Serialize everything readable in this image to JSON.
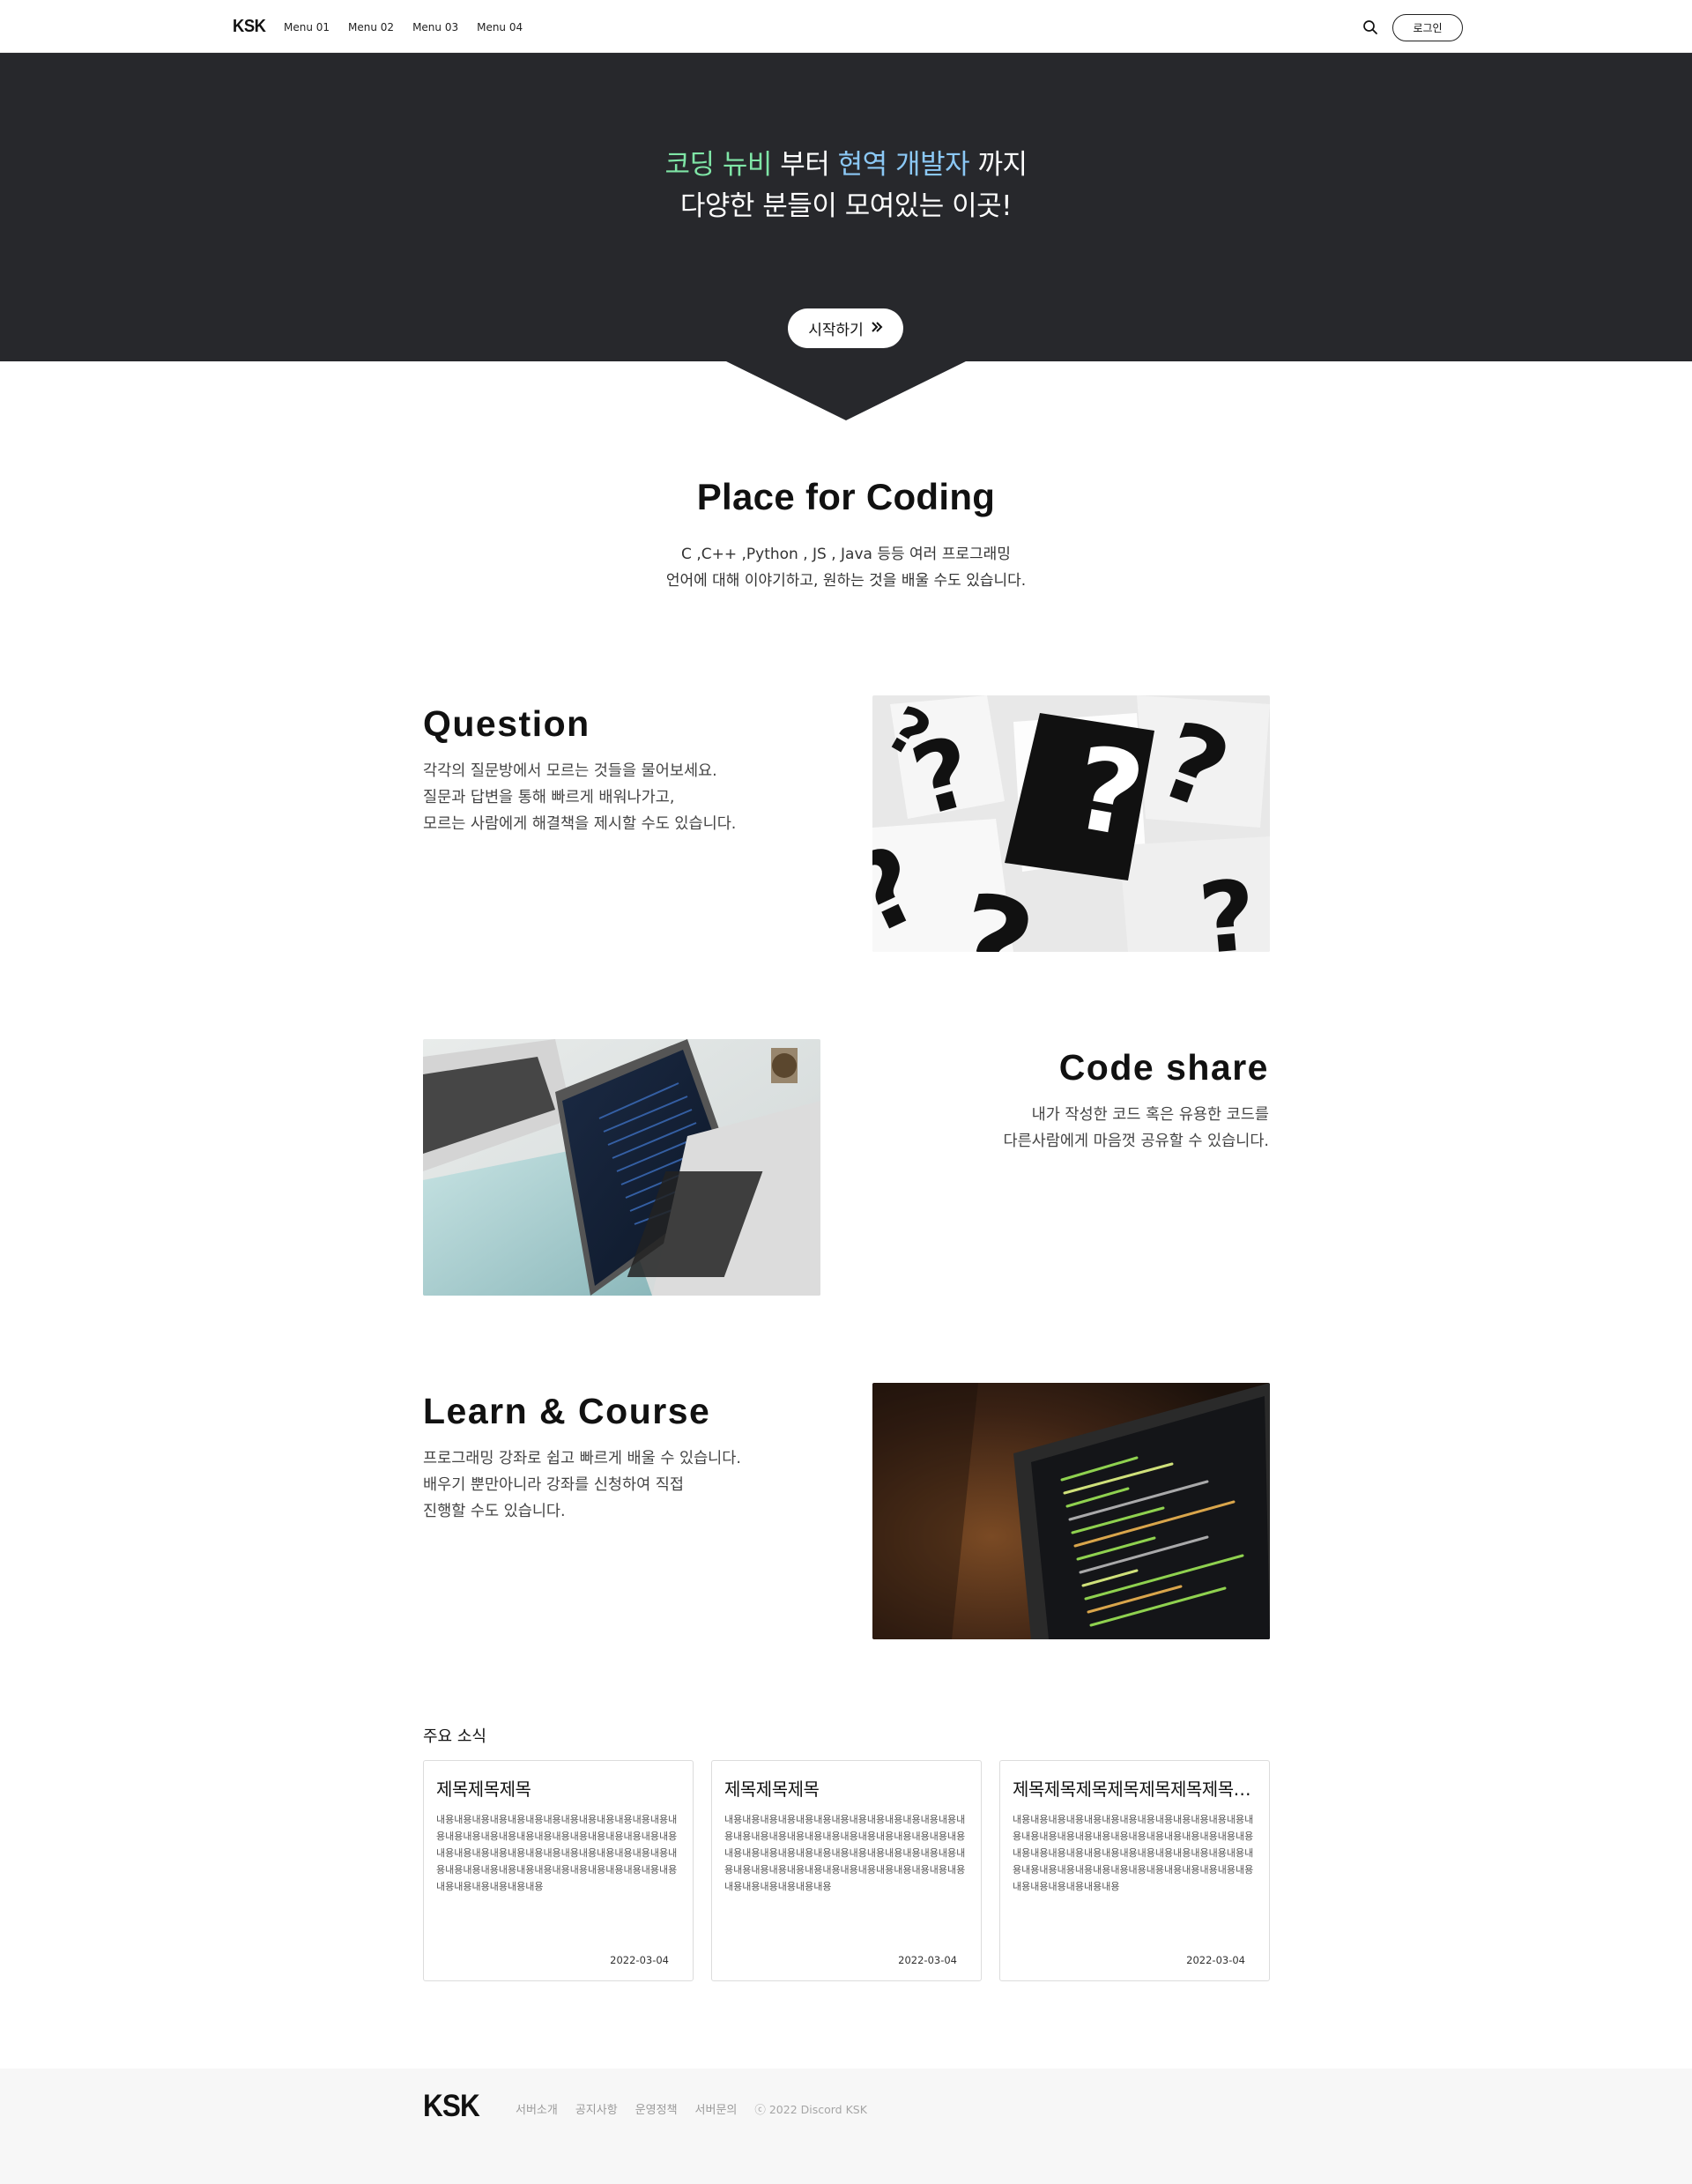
{
  "header": {
    "logo": "KSK",
    "nav": [
      "Menu 01",
      "Menu 02",
      "Menu 03",
      "Menu 04"
    ],
    "search_icon": "search-icon",
    "login_label": "로그인"
  },
  "hero": {
    "line1": {
      "part1": "코딩 뉴비",
      "part2": " 부터 ",
      "part3": "현역 개발자",
      "part4": " 까지"
    },
    "line2": "다양한 분들이 모여있는 이곳!",
    "cta_label": "시작하기",
    "cta_icon": "double-chevron-right-icon",
    "colors": {
      "background": "#27282c",
      "highlight_green": "#7fe5a6",
      "highlight_blue": "#8bc8f5"
    }
  },
  "intro": {
    "title": "Place for Coding",
    "desc_line1": "C ,C++ ,Python , JS , Java 등등 여러 프로그래밍",
    "desc_line2": "언어에 대해 이야기하고, 원하는 것을 배울 수도 있습니다."
  },
  "features": [
    {
      "title": "Question",
      "lines": [
        "각각의 질문방에서 모르는 것들을 물어보세요.",
        "질문과 답변을 통해 빠르게 배워나가고,",
        "모르는 사람에게 해결책을 제시할 수도 있습니다."
      ],
      "image": "question-marks-photo"
    },
    {
      "title": "Code share",
      "lines": [
        "내가 작성한 코드 혹은 유용한 코드를",
        "다른사람에게 마음껏 공유할 수 있습니다."
      ],
      "image": "laptops-photo"
    },
    {
      "title": "Learn & Course",
      "lines": [
        "프로그래밍 강좌로 쉽고 빠르게 배울 수 있습니다.",
        "배우기 뿐만아니라 강좌를 신청하여 직접",
        "진행할 수도 있습니다."
      ],
      "image": "code-monitor-photo"
    }
  ],
  "news": {
    "heading": "주요 소식",
    "items": [
      {
        "title": "제목제목제목",
        "body": "내용내용내용내용내용내용내용내용내용내용내용내용내용내용내용내용내용내용내용내용내용내용내용내용내용내용내용내용내용내용내용내용내용내용내용내용내용내용내용내용내용내용내용내용내용내용내용내용내용내용내용내용내용내용내용내용내용내용내용내용",
        "date": "2022-03-04"
      },
      {
        "title": "제목제목제목",
        "body": "내용내용내용내용내용내용내용내용내용내용내용내용내용내용내용내용내용내용내용내용내용내용내용내용내용내용내용내용내용내용내용내용내용내용내용내용내용내용내용내용내용내용내용내용내용내용내용내용내용내용내용내용내용내용내용내용내용내용내용내용",
        "date": "2022-03-04"
      },
      {
        "title": "제목제목제목제목제목제목제목제목제목제목",
        "body": "내용내용내용내용내용내용내용내용내용내용내용내용내용내용내용내용내용내용내용내용내용내용내용내용내용내용내용내용내용내용내용내용내용내용내용내용내용내용내용내용내용내용내용내용내용내용내용내용내용내용내용내용내용내용내용내용내용내용내용내용",
        "date": "2022-03-04"
      }
    ]
  },
  "footer": {
    "logo": "KSK",
    "links": [
      "서버소개",
      "공지사항",
      "운영정책",
      "서버문의"
    ],
    "copyright": "ⓒ 2022 Discord KSK"
  }
}
